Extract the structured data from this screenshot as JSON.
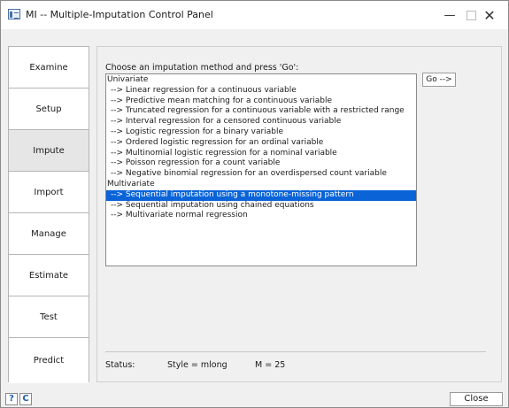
{
  "window": {
    "title": "MI -- Multiple-Imputation Control Panel",
    "min_glyph": "—",
    "close_glyph": "✕"
  },
  "sidebar": {
    "items": [
      {
        "label": "Examine"
      },
      {
        "label": "Setup"
      },
      {
        "label": "Impute",
        "active": true
      },
      {
        "label": "Import"
      },
      {
        "label": "Manage"
      },
      {
        "label": "Estimate"
      },
      {
        "label": "Test"
      },
      {
        "label": "Predict"
      }
    ]
  },
  "impute": {
    "prompt": "Choose an imputation method and press 'Go':",
    "go_label": "Go -->",
    "list": [
      {
        "text": "Univariate",
        "type": "header"
      },
      {
        "text": "--> Linear regression for a continuous variable",
        "type": "item"
      },
      {
        "text": "--> Predictive mean matching for a continuous variable",
        "type": "item"
      },
      {
        "text": "--> Truncated regression for a continuous variable with a restricted range",
        "type": "item"
      },
      {
        "text": "--> Interval regression for a censored continuous variable",
        "type": "item"
      },
      {
        "text": "--> Logistic regression for a binary variable",
        "type": "item"
      },
      {
        "text": "--> Ordered logistic regression for an ordinal variable",
        "type": "item"
      },
      {
        "text": "--> Multinomial logistic regression for a nominal variable",
        "type": "item"
      },
      {
        "text": "--> Poisson regression for a count variable",
        "type": "item"
      },
      {
        "text": "--> Negative binomial regression for an overdispersed count variable",
        "type": "item"
      },
      {
        "text": "Multivariate",
        "type": "header"
      },
      {
        "text": "--> Sequential imputation using a monotone-missing pattern",
        "type": "item",
        "selected": true
      },
      {
        "text": "--> Sequential imputation using chained equations",
        "type": "item"
      },
      {
        "text": "--> Multivariate normal regression",
        "type": "item"
      }
    ]
  },
  "status": {
    "label": "Status:",
    "style": "Style = mlong",
    "m": "M = 25"
  },
  "bottom": {
    "help_glyph": "?",
    "refresh_glyph": "C",
    "close_label": "Close"
  },
  "colors": {
    "selection": "#0a64d8",
    "desktop": "#1d4f86"
  }
}
